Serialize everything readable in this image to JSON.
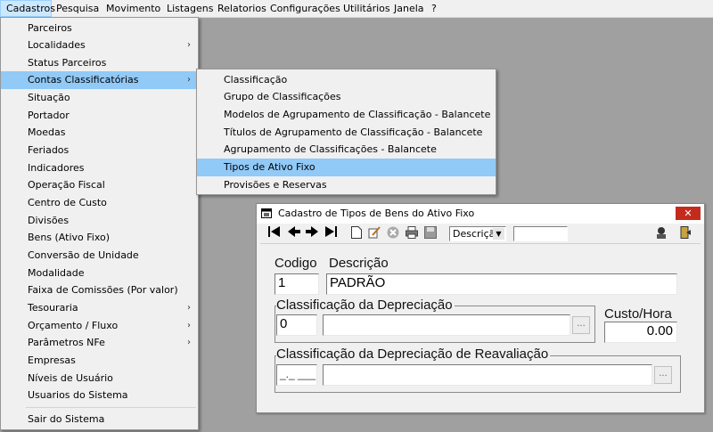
{
  "menubar": [
    {
      "label": "Cadastros",
      "active": true
    },
    {
      "label": "Pesquisa"
    },
    {
      "label": "Movimento"
    },
    {
      "label": "Listagens"
    },
    {
      "label": "Relatorios"
    },
    {
      "label": "Configurações"
    },
    {
      "label": "Utilitários"
    },
    {
      "label": "Janela"
    },
    {
      "label": "?"
    }
  ],
  "cadastros_menu": [
    {
      "label": "Parceiros"
    },
    {
      "label": "Localidades",
      "submenu": true
    },
    {
      "label": "Status Parceiros"
    },
    {
      "label": "Contas Classificatórias",
      "submenu": true,
      "highlighted": true
    },
    {
      "label": "Situação"
    },
    {
      "label": "Portador"
    },
    {
      "label": "Moedas"
    },
    {
      "label": "Feriados"
    },
    {
      "label": "Indicadores"
    },
    {
      "label": "Operação Fiscal"
    },
    {
      "label": "Centro de Custo"
    },
    {
      "label": "Divisões"
    },
    {
      "label": "Bens (Ativo Fixo)"
    },
    {
      "label": "Conversão de Unidade"
    },
    {
      "label": "Modalidade"
    },
    {
      "label": "Faixa de Comissões (Por valor)"
    },
    {
      "label": "Tesouraria",
      "submenu": true
    },
    {
      "label": "Orçamento / Fluxo",
      "submenu": true
    },
    {
      "label": "Parâmetros NFe",
      "submenu": true
    },
    {
      "label": "Empresas"
    },
    {
      "label": "Níveis de Usuário"
    },
    {
      "label": "Usuarios do Sistema"
    },
    {
      "label": "Sair do Sistema"
    }
  ],
  "contas_submenu": [
    {
      "label": "Classificação"
    },
    {
      "label": "Grupo de Classificações"
    },
    {
      "label": "Modelos de Agrupamento de Classificação - Balancete"
    },
    {
      "label": "Títulos de Agrupamento de Classificação - Balancete"
    },
    {
      "label": "Agrupamento de Classificações - Balancete"
    },
    {
      "label": "Tipos de Ativo Fixo",
      "highlighted": true
    },
    {
      "label": "Provisões e Reservas"
    }
  ],
  "window": {
    "title": "Cadastro de Tipos de Bens do Ativo Fixo",
    "close_label": "✕",
    "search_field_selected": "Descrição",
    "search_value": "",
    "codigo_label": "Codigo",
    "descricao_label": "Descrição",
    "codigo_value": "1",
    "descricao_value": "PADRÃO",
    "class_depreciacao_label": "Classificação da Depreciação",
    "class_depreciacao_code": "0",
    "class_depreciacao_desc": "",
    "custo_hora_label": "Custo/Hora",
    "custo_hora_value": "0.00",
    "class_reavaliacao_label": "Classificação da Depreciação de Reavaliação",
    "class_reavaliacao_code": "_._ ___",
    "class_reavaliacao_desc": "",
    "lookup_label": "..."
  },
  "icons": {
    "first": "first-record-icon",
    "prev": "prev-record-icon",
    "next": "next-record-icon",
    "last": "last-record-icon",
    "new": "new-record-icon",
    "edit": "edit-record-icon",
    "delete": "delete-record-icon",
    "print": "print-icon",
    "save": "save-icon",
    "user": "user-icon",
    "exit": "exit-door-icon"
  }
}
